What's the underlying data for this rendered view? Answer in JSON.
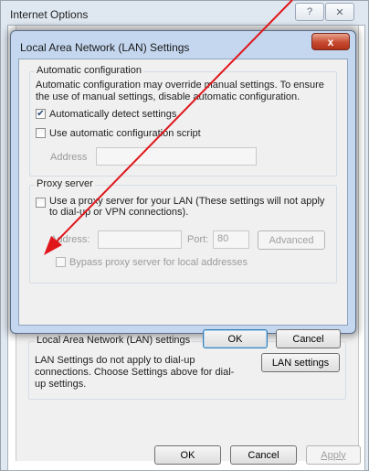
{
  "outer_window": {
    "title": "Internet Options",
    "help_label": "?",
    "close_label": "✕",
    "lan_group": {
      "title": "Local Area Network (LAN) settings",
      "text": "LAN Settings do not apply to dial-up connections. Choose Settings above for dial-up settings.",
      "lan_settings_button": "LAN settings"
    },
    "footer": {
      "ok": "OK",
      "cancel": "Cancel",
      "apply": "Apply"
    }
  },
  "dialog": {
    "title": "Local Area Network (LAN) Settings",
    "close_label": "x",
    "auto_config": {
      "title": "Automatic configuration",
      "description": "Automatic configuration may override manual settings.  To ensure the use of manual settings, disable automatic configuration.",
      "auto_detect": {
        "label": "Automatically detect settings",
        "checked": true
      },
      "use_script": {
        "label": "Use automatic configuration script",
        "checked": false
      },
      "address_label": "Address",
      "address_value": ""
    },
    "proxy": {
      "title": "Proxy server",
      "use_proxy": {
        "label": "Use a proxy server for your LAN (These settings will not apply to dial-up or VPN connections).",
        "checked": false
      },
      "address_label": "Address:",
      "address_value": "",
      "port_label": "Port:",
      "port_value": "80",
      "advanced_button": "Advanced",
      "bypass": {
        "label": "Bypass proxy server for local addresses",
        "checked": false
      }
    },
    "buttons": {
      "ok": "OK",
      "cancel": "Cancel"
    }
  },
  "annotation": {
    "color": "#e0161b"
  }
}
